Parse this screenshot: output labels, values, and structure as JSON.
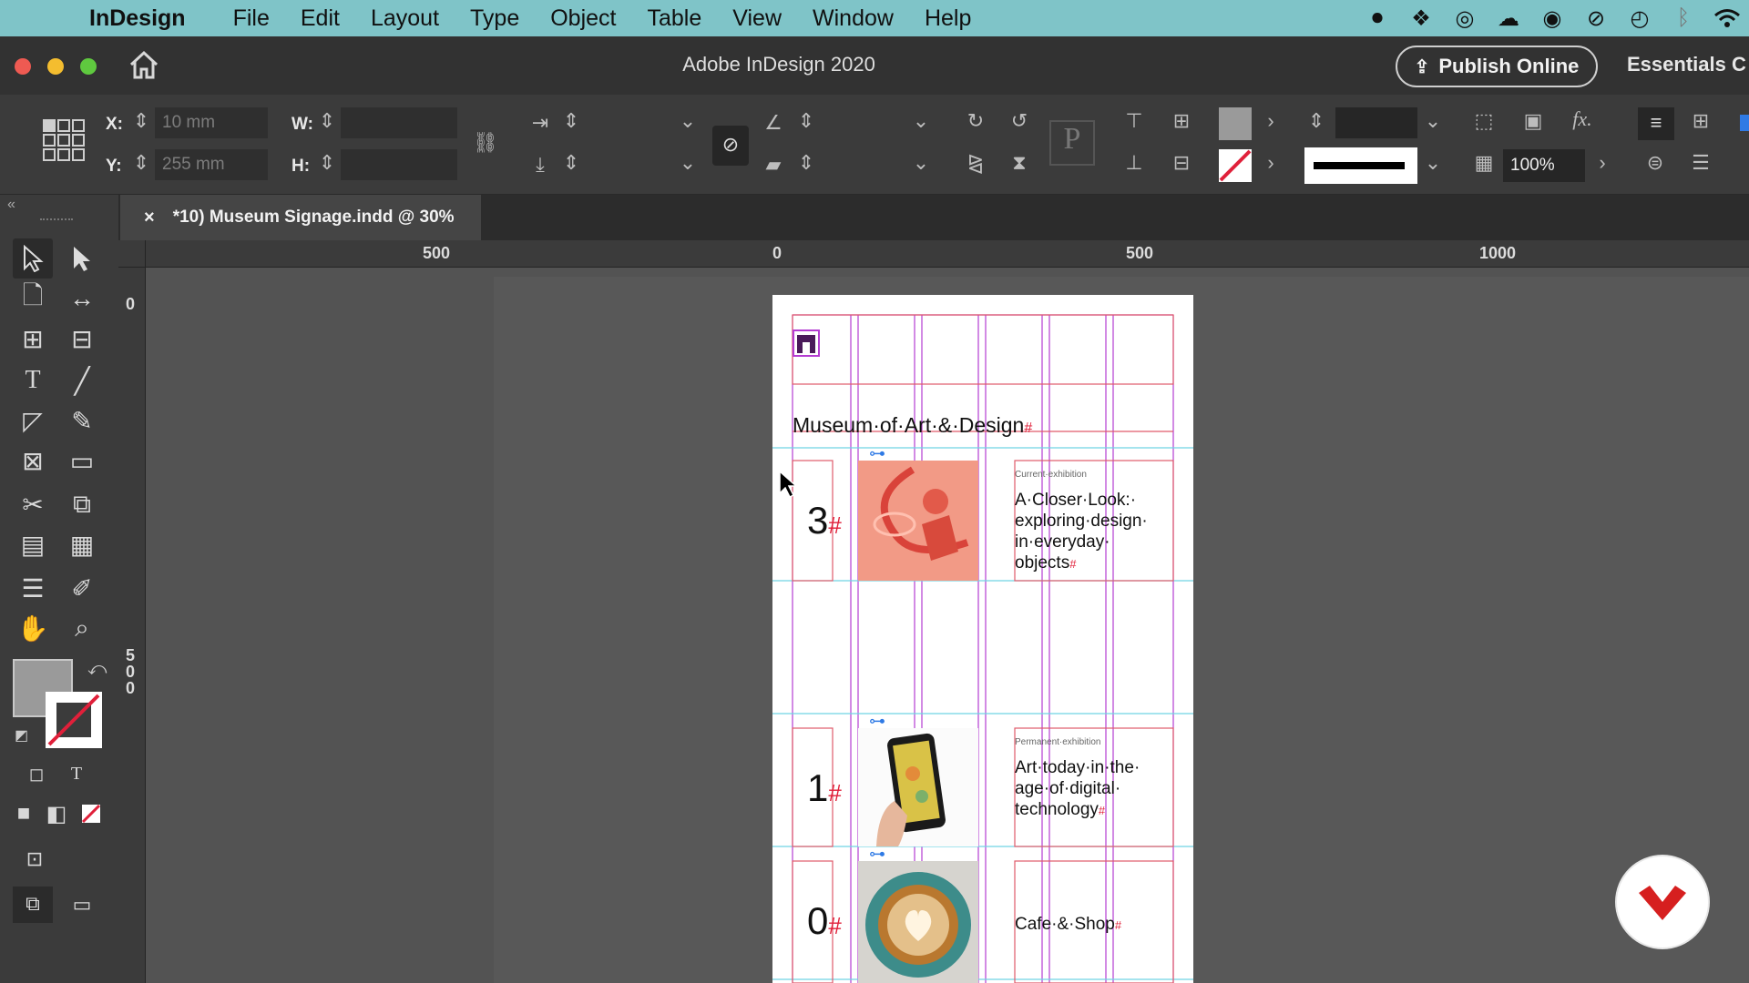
{
  "menubar": {
    "app_name": "InDesign",
    "items": [
      "File",
      "Edit",
      "Layout",
      "Type",
      "Object",
      "Table",
      "View",
      "Window",
      "Help"
    ]
  },
  "titlebar": {
    "title": "Adobe InDesign 2020",
    "publish_label": "Publish Online",
    "workspace_label": "Essentials C"
  },
  "control": {
    "x_label": "X:",
    "x_value": "10 mm",
    "y_label": "Y:",
    "y_value": "255 mm",
    "w_label": "W:",
    "h_label": "H:",
    "opacity_value": "100%"
  },
  "tab": {
    "close": "×",
    "label": "*10) Museum Signage.indd @ 30%"
  },
  "ruler": {
    "h_labels": [
      "500",
      "0",
      "500",
      "1000"
    ],
    "v_labels": [
      "0",
      "5",
      "0",
      "0"
    ]
  },
  "document": {
    "title": "Museum·of·Art·&·Design",
    "title_mark": "#",
    "rows": [
      {
        "number": "3",
        "kicker": "Current·exhibition",
        "headline": [
          "A·Closer·Look:·",
          "exploring·design·",
          "in·everyday·",
          "objects"
        ]
      },
      {
        "number": "1",
        "kicker": "Permanent·exhibition",
        "headline": [
          "Art·today·in·the·",
          "age·of·digital·",
          "technology"
        ]
      },
      {
        "number": "0",
        "kicker": "",
        "headline": [
          "Cafe·&·Shop"
        ]
      }
    ],
    "hash": "#"
  },
  "colors": {
    "menubar": "#7fc4c8",
    "accent_red": "#e0203a",
    "frame_magenta": "#b43cd2",
    "guide_cyan": "#6fd3e3"
  }
}
